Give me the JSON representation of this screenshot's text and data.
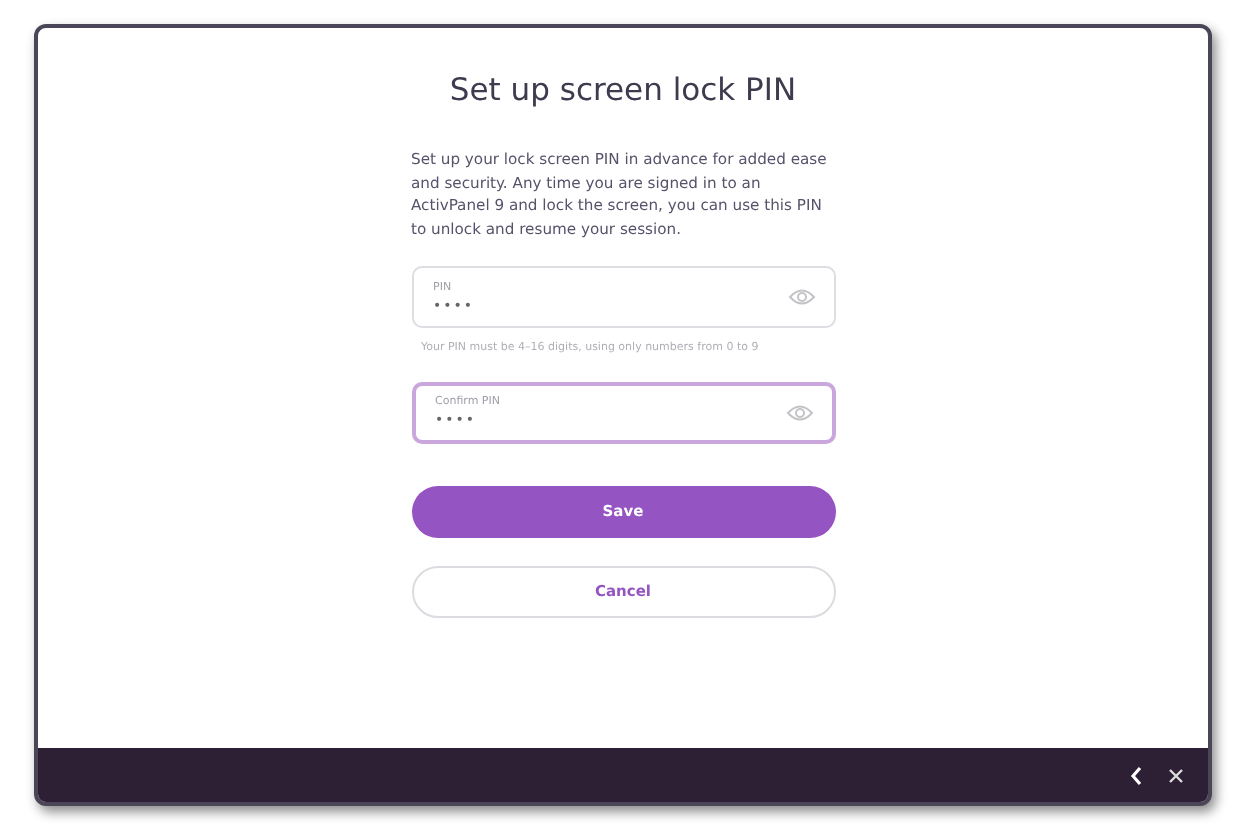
{
  "dialog": {
    "title": "Set up screen lock PIN",
    "description": "Set up your lock screen PIN in advance for added ease and security. Any time you are signed in to an ActivPanel 9 and lock the screen, you can use this PIN to unlock and resume your session.",
    "fields": [
      {
        "label": "PIN",
        "value": "••••",
        "focused": false
      },
      {
        "label": "Confirm PIN",
        "value": "••••",
        "focused": true
      }
    ],
    "hint": "Your PIN must be 4–16 digits, using only numbers from 0 to 9",
    "buttons": [
      {
        "label": "Save",
        "kind": "primary"
      },
      {
        "label": "Cancel",
        "kind": "secondary"
      }
    ]
  }
}
